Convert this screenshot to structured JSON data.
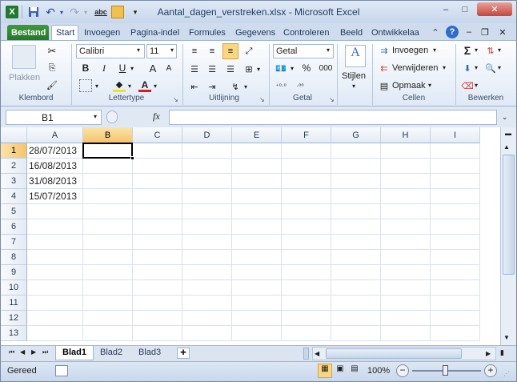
{
  "window": {
    "title": "Aantal_dagen_verstreken.xlsx - Microsoft Excel",
    "minimize": "–",
    "maximize": "□",
    "close": "✕"
  },
  "qat": {
    "excel_icon": "X",
    "save": "💾",
    "undo": "↶",
    "redo": "↷",
    "spell": "abc",
    "customize": "▾"
  },
  "tabs": [
    "Bestand",
    "Start",
    "Invoegen",
    "Pagina-indel",
    "Formules",
    "Gegevens",
    "Controleren",
    "Beeld",
    "Ontwikkelaa"
  ],
  "ribbon": {
    "clipboard": {
      "paste": "Plakken",
      "label": "Klembord"
    },
    "font": {
      "name": "Calibri",
      "size": "11",
      "bold": "B",
      "italic": "I",
      "underline": "U",
      "grow": "A",
      "shrink": "A",
      "color": "A",
      "label": "Lettertype"
    },
    "alignment": {
      "label": "Uitlijning"
    },
    "number": {
      "format": "Getal",
      "percent": "%",
      "thousands": "000",
      "label": "Getal"
    },
    "styles": {
      "label": "Stijlen"
    },
    "cells": {
      "insert": "Invoegen",
      "delete": "Verwijderen",
      "format": "Opmaak",
      "label": "Cellen"
    },
    "editing": {
      "sum": "Σ",
      "label": "Bewerken"
    }
  },
  "formula_bar": {
    "name_box": "B1",
    "fx": "fx",
    "value": ""
  },
  "columns": [
    "A",
    "B",
    "C",
    "D",
    "E",
    "F",
    "G",
    "H",
    "I"
  ],
  "rows": [
    "1",
    "2",
    "3",
    "4",
    "5",
    "6",
    "7",
    "8",
    "9",
    "10",
    "11",
    "12",
    "13"
  ],
  "cells": {
    "A1": "28/07/2013",
    "A2": "16/08/2013",
    "A3": "31/08/2013",
    "A4": "15/07/2013"
  },
  "sheets": [
    "Blad1",
    "Blad2",
    "Blad3"
  ],
  "status": {
    "ready": "Gereed",
    "zoom": "100%",
    "zoom_out": "−",
    "zoom_in": "+"
  },
  "colors": {
    "file_tab": "#2e8b2e",
    "selection": "#f5c56a",
    "accent": "#1e395b"
  }
}
